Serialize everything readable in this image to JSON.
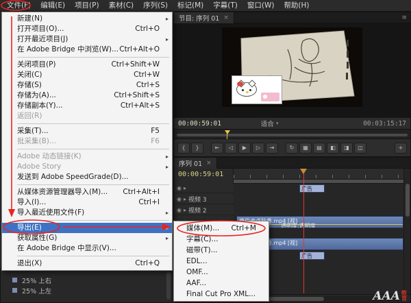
{
  "theme": {
    "annotation_red": "#e8251f",
    "menu_highlight_blue": "#3f72c4",
    "clip_blue": "#5b7db1",
    "timecode_yellow": "#d8d48a"
  },
  "menu_bar": {
    "items": [
      "文件(F)",
      "编辑(E)",
      "项目(P)",
      "素材(C)",
      "序列(S)",
      "标记(M)",
      "字幕(T)",
      "窗口(W)",
      "帮助(H)"
    ]
  },
  "file_menu": {
    "items": [
      {
        "label": "新建(N)"
      },
      {
        "label": "打开项目(O)...",
        "shortcut": "Ctrl+O"
      },
      {
        "label": "打开最近项目(J)"
      },
      {
        "label": "在 Adobe Bridge 中浏览(W)...",
        "shortcut": "Ctrl+Alt+O"
      },
      {
        "label": "关闭项目(P)",
        "shortcut": "Ctrl+Shift+W"
      },
      {
        "label": "关闭(C)",
        "shortcut": "Ctrl+W"
      },
      {
        "label": "存储(S)",
        "shortcut": "Ctrl+S"
      },
      {
        "label": "存储为(A)...",
        "shortcut": "Ctrl+Shift+S"
      },
      {
        "label": "存储副本(Y)...",
        "shortcut": "Ctrl+Alt+S"
      },
      {
        "label": "返回(R)"
      },
      {
        "label": "采集(T)...",
        "shortcut": "F5"
      },
      {
        "label": "批采集(B)...",
        "shortcut": "F6"
      },
      {
        "label": "Adobe 动态链接(K)"
      },
      {
        "label": "Adobe Story"
      },
      {
        "label": "发送到 Adobe SpeedGrade(D)..."
      },
      {
        "label": "从媒体资源管理器导入(M)...",
        "shortcut": "Ctrl+Alt+I"
      },
      {
        "label": "导入(I)...",
        "shortcut": "Ctrl+I"
      },
      {
        "label": "导入最近使用文件(F)"
      },
      {
        "label": "导出(E)"
      },
      {
        "label": "获取属性(G)"
      },
      {
        "label": "在 Adobe Bridge 中显示(V)..."
      },
      {
        "label": "退出(X)",
        "shortcut": "Ctrl+Q"
      }
    ],
    "submenu_arrow": "▸"
  },
  "export_submenu": {
    "items": [
      {
        "label": "媒体(M)...",
        "shortcut": "Ctrl+M"
      },
      {
        "label": "字幕(C)..."
      },
      {
        "label": "磁带(T)..."
      },
      {
        "label": "EDL..."
      },
      {
        "label": "OMF..."
      },
      {
        "label": "AAF..."
      },
      {
        "label": "Final Cut Pro XML..."
      }
    ]
  },
  "program_monitor": {
    "tab_title": "节目: 序列 01",
    "close_glyph": "×",
    "panel_menu_glyph": "≡",
    "current_time": "00:00:59:01",
    "fit_label": "适合",
    "dropdown_arrow": "▾",
    "duration": "00:03:15:17",
    "transport": [
      {
        "name": "mark-in",
        "glyph": "{"
      },
      {
        "name": "mark-out",
        "glyph": "}"
      },
      {
        "name": "go-to-in",
        "glyph": "⇤"
      },
      {
        "name": "step-back",
        "glyph": "◁"
      },
      {
        "name": "play",
        "glyph": "▶"
      },
      {
        "name": "step-forward",
        "glyph": "▷"
      },
      {
        "name": "go-to-out",
        "glyph": "⇥"
      },
      {
        "name": "loop",
        "glyph": "↻"
      },
      {
        "name": "safe-margins",
        "glyph": "▦"
      },
      {
        "name": "output",
        "glyph": "▤"
      },
      {
        "name": "lift",
        "glyph": "◧"
      },
      {
        "name": "extract",
        "glyph": "◨"
      },
      {
        "name": "export-frame",
        "glyph": "◫"
      }
    ],
    "add_button_glyph": "+"
  },
  "timeline": {
    "tab_title": "序列 01",
    "close_glyph": "×",
    "timecode": "00:00:59:01",
    "track_toggle_glyph": "◉",
    "track_twirl_glyph": "▸",
    "tracks": [
      "视频 3",
      "视频 2"
    ],
    "clips": [
      {
        "label": "广告"
      },
      {
        "label": "唐伯虎点秋香.mp4 [视]",
        "fx": "透明度:透明度"
      },
      {
        "label": "唐伯虎点秋香.mp4 [视]"
      },
      {
        "label": "广告"
      }
    ]
  },
  "project_panel": {
    "items": [
      "25% 上右",
      "25% 上左"
    ]
  },
  "watermark": {
    "main": "AAA",
    "sub1": "教",
    "sub2": "育"
  }
}
